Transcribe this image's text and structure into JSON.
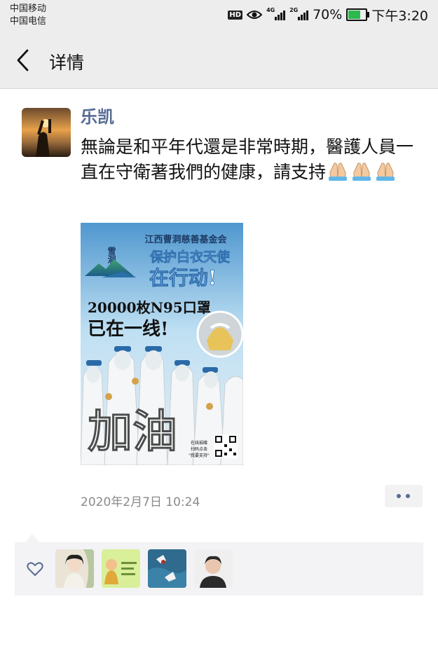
{
  "status_bar": {
    "carrier_1": "中国移动",
    "carrier_2": "中国电信",
    "hd_badge": "HD",
    "net_1": "4G",
    "net_2": "2G",
    "battery_pct": "70%",
    "time": "下午3:20",
    "battery_level": 0.7
  },
  "nav": {
    "title": "详情"
  },
  "post": {
    "author": "乐凯",
    "text": "無論是和平年代還是非常時期，醫護人員一直在守衛著我們的健康，請支持",
    "emoji": "praying-hands x3",
    "poster": {
      "org": "江西曹洞慈善基金会",
      "headline_1": "保护白衣天使",
      "headline_2": "在行动!",
      "count_line": "20000枚N95口罩",
      "count_line_2": "已在一线!",
      "logo_text": "雪洞",
      "calligraphy": "加油",
      "qr_caption_1": "在线捐赠",
      "qr_caption_2": "扫码点击",
      "qr_caption_3": "\"我要支持\""
    },
    "timestamp": "2020年2月7日 10:24"
  },
  "likes": {
    "count_avatars": 4
  },
  "colors": {
    "link": "#576b95",
    "bg_bar": "#ededed",
    "like_bg": "#f3f3f5"
  }
}
